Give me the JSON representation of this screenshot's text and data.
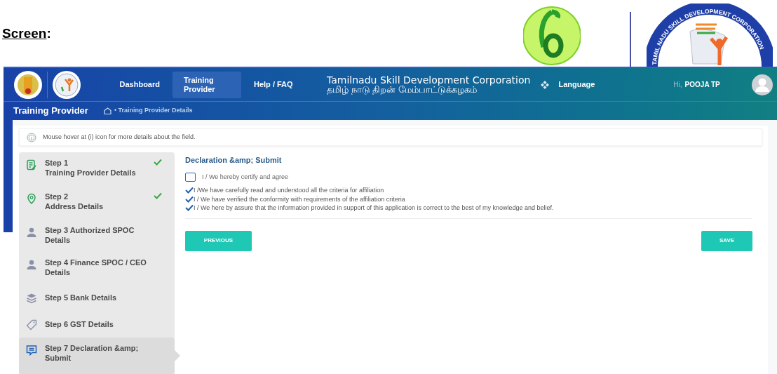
{
  "document": {
    "heading": "Screen",
    "heading_suffix": ":",
    "logo_text": "TAMIL NADU SKILL DEVELOPMENT CORPORATION"
  },
  "header": {
    "nav": [
      {
        "label": "Dashboard",
        "selected": false
      },
      {
        "label": "Training Provider",
        "selected": true
      },
      {
        "label": "Help / FAQ",
        "selected": false
      }
    ],
    "org_title_en": "Tamilnadu Skill Development Corporation",
    "org_title_ta": "தமிழ் நாடு திறன் மேம்பாட்டுக்கழகம்",
    "language": "Language",
    "greeting": "Hi,",
    "user": "POOJA TP"
  },
  "subheader": {
    "title": "Training Provider",
    "breadcrumb": "• Training Provider Details"
  },
  "info": "Mouse hover at (i) icon for more details about the field.",
  "steps": [
    {
      "kind": "form",
      "label": "Step 1",
      "sublabel": "Training Provider Details",
      "done": true,
      "selected": false
    },
    {
      "kind": "pin",
      "label": "Step 2",
      "sublabel": "Address Details",
      "done": true,
      "selected": false
    },
    {
      "kind": "person",
      "label": "Step 3 Authorized SPOC Details",
      "done": false,
      "selected": false
    },
    {
      "kind": "person",
      "label": "Step 4 Finance SPOC / CEO Details",
      "done": false,
      "selected": false
    },
    {
      "kind": "layers",
      "label": "Step 5 Bank Details",
      "done": false,
      "selected": false
    },
    {
      "kind": "tag",
      "label": "Step 6 GST Details",
      "done": false,
      "selected": false
    },
    {
      "kind": "message",
      "label": "Step 7 Declaration &amp; Submit",
      "done": false,
      "selected": true
    }
  ],
  "declaration": {
    "title": "Declaration &amp; Submit",
    "agree": {
      "label": "I / We hereby certify and agree",
      "checked": false
    },
    "statements": [
      {
        "text": "I /We have carefully read and understood all the criteria for affiliation",
        "checked": true
      },
      {
        "text": "I / We have verified the conformity with requirements of the affiliation criteria",
        "checked": true
      },
      {
        "text": "I / We here by assure that the information provided in support of this application is correct to the best of my knowledge and belief.",
        "checked": true
      }
    ]
  },
  "buttons": {
    "previous": "PREVIOUS",
    "save": "SAVE"
  }
}
